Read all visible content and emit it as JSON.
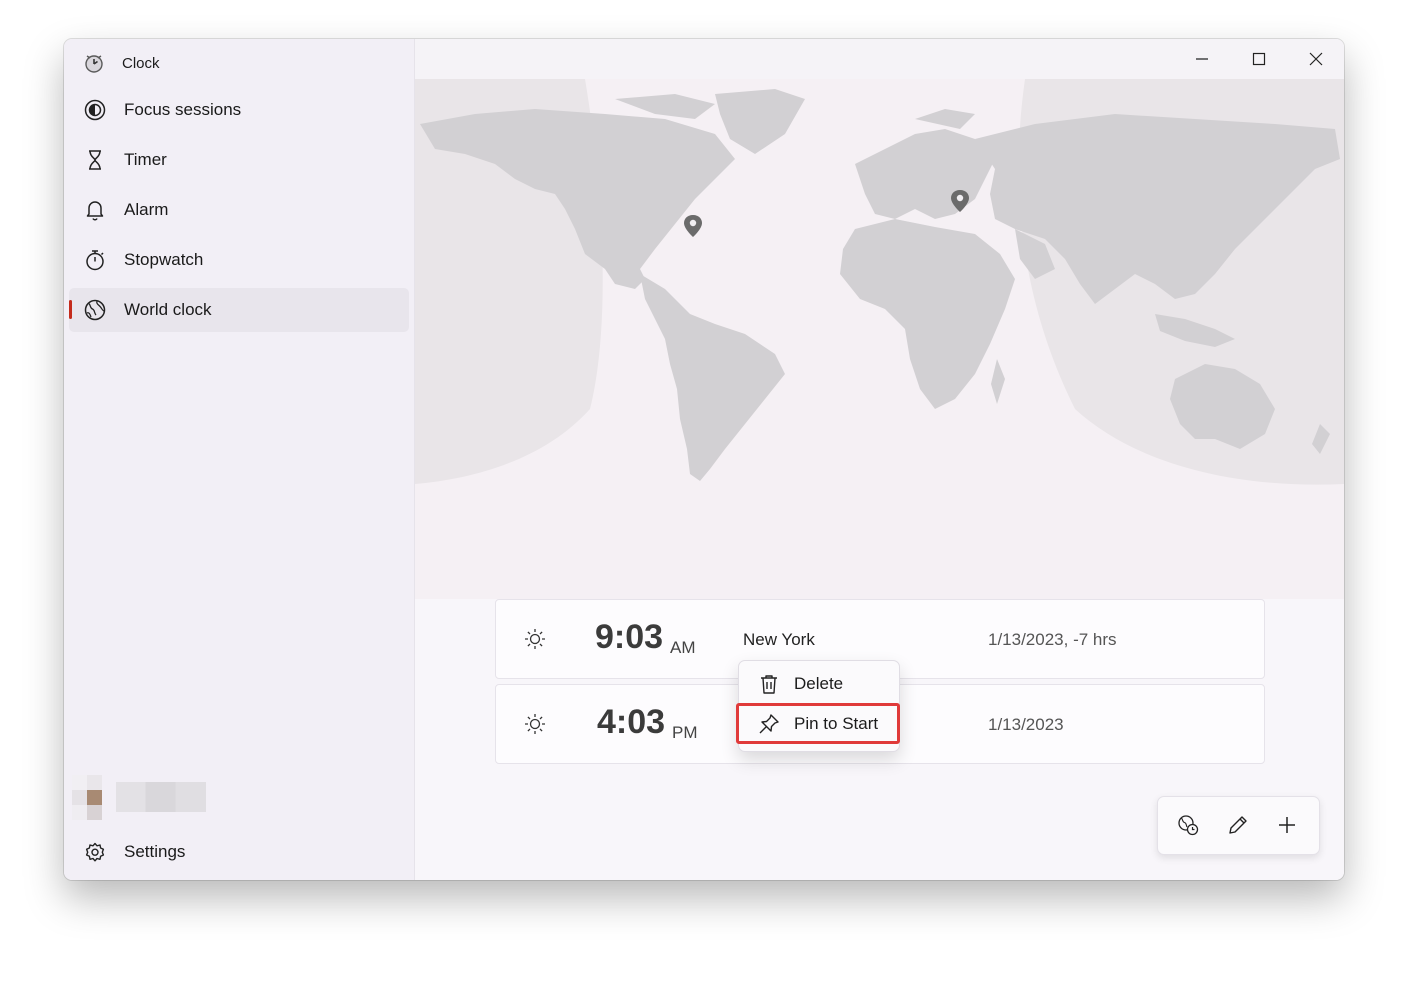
{
  "app": {
    "title": "Clock"
  },
  "sidebar": {
    "items": [
      {
        "label": "Focus sessions",
        "icon": "focus-icon"
      },
      {
        "label": "Timer",
        "icon": "hourglass-icon"
      },
      {
        "label": "Alarm",
        "icon": "bell-icon"
      },
      {
        "label": "Stopwatch",
        "icon": "stopwatch-icon"
      },
      {
        "label": "World clock",
        "icon": "globe-icon",
        "selected": true
      }
    ],
    "settings_label": "Settings"
  },
  "clocks": [
    {
      "time": "9:03",
      "ampm": "AM",
      "city": "New York",
      "date": "1/13/2023, -7 hrs",
      "icon": "sun-icon"
    },
    {
      "time": "4:03",
      "ampm": "PM",
      "city": "",
      "date": "1/13/2023",
      "icon": "sun-icon"
    }
  ],
  "context_menu": {
    "delete_label": "Delete",
    "pin_label": "Pin to Start"
  },
  "colors": {
    "accent": "#c42b1c",
    "highlight": "#e03a3a"
  }
}
